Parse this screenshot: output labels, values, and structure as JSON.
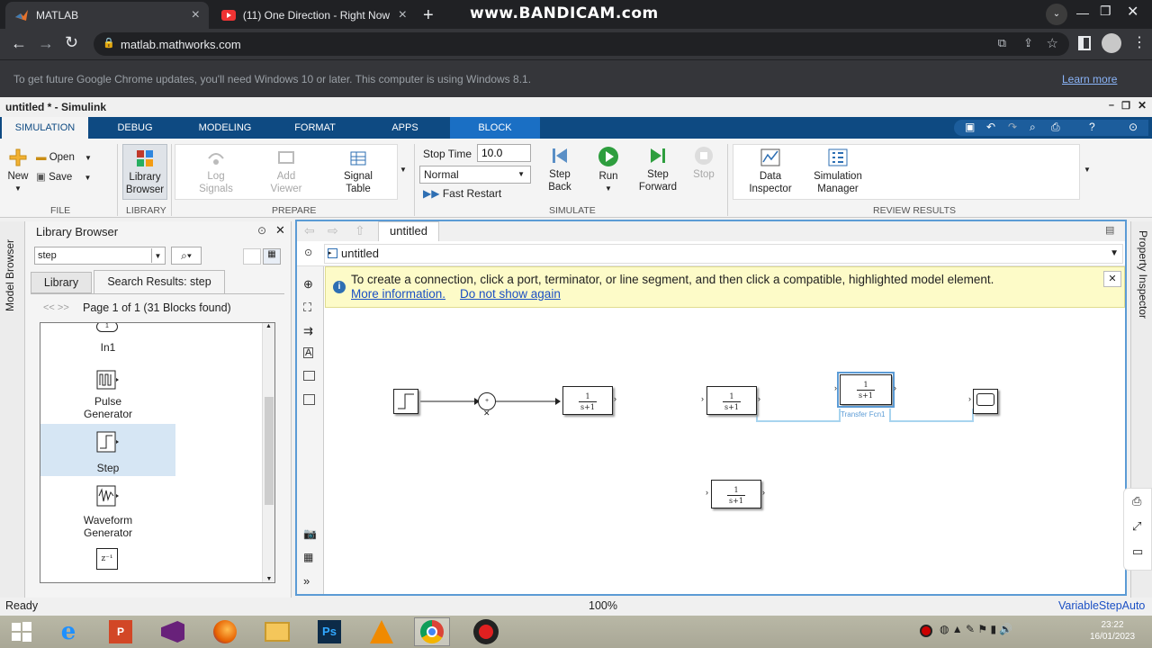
{
  "browser": {
    "tabs": [
      {
        "title": "MATLAB",
        "active": true
      },
      {
        "title": "(11) One Direction - Right Now (",
        "active": false
      }
    ],
    "watermark": "www.BANDICAM.com",
    "url": "matlab.mathworks.com",
    "infobar": {
      "message": "To get future Google Chrome updates, you'll need Windows 10 or later. This computer is using Windows 8.1.",
      "link": "Learn more"
    }
  },
  "window": {
    "title": "untitled * - Simulink"
  },
  "ribbon_tabs": [
    "SIMULATION",
    "DEBUG",
    "MODELING",
    "FORMAT",
    "APPS",
    "BLOCK"
  ],
  "ribbon": {
    "file": {
      "new": "New",
      "open": "Open",
      "save": "Save",
      "label": "FILE"
    },
    "library": {
      "browser": "Library Browser",
      "label": "LIBRARY"
    },
    "prepare": {
      "log_signals": "Log Signals",
      "add_viewer": "Add Viewer",
      "signal_table": "Signal Table",
      "label": "PREPARE"
    },
    "simulate": {
      "stop_time_label": "Stop Time",
      "stop_time_value": "10.0",
      "mode": "Normal",
      "fast_restart": "Fast Restart",
      "step_back": "Step Back",
      "run": "Run",
      "step_forward": "Step Forward",
      "stop": "Stop",
      "label": "SIMULATE"
    },
    "review": {
      "data_inspector": "Data Inspector",
      "simulation_manager": "Simulation Manager",
      "label": "REVIEW RESULTS"
    }
  },
  "side_strip": {
    "model_browser": "Model Browser",
    "property_inspector": "Property Inspector"
  },
  "library_browser": {
    "title": "Library Browser",
    "search_value": "step",
    "tabs": [
      "Library",
      "Search Results: step"
    ],
    "page_info": "Page 1 of 1 (31 Blocks found)",
    "page_nav": "<< >>",
    "items": [
      {
        "label": "In1"
      },
      {
        "label": "Pulse Generator"
      },
      {
        "label": "Step",
        "selected": true
      },
      {
        "label": "Waveform Generator"
      },
      {
        "label": "z⁻¹"
      }
    ]
  },
  "editor": {
    "tab": "untitled",
    "breadcrumb": "untitled",
    "banner": {
      "message": "To create a connection, click a port, terminator, or line segment, and then click a compatible, highlighted model element.",
      "link1": "More information.",
      "link2": "Do not show again"
    },
    "block_tf": {
      "num": "1",
      "den": "s+1"
    },
    "selected_block_name": "Transfer Fcn1"
  },
  "status": {
    "left": "Ready",
    "zoom": "100%",
    "solver": "VariableStepAuto"
  },
  "taskbar": {
    "time": "23:22",
    "date": "16/01/2023"
  }
}
